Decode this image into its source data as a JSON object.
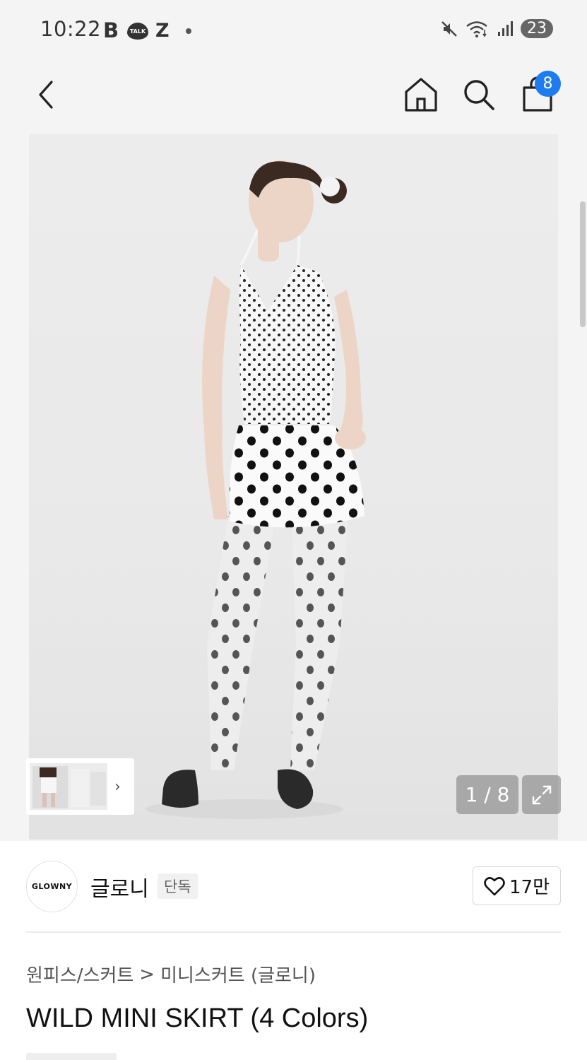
{
  "status_bar": {
    "time": "10:22",
    "icons": [
      "b-app-icon",
      "kakaotalk-icon",
      "z-app-icon",
      "dot-icon"
    ],
    "talk_label": "TALK",
    "b_label": "B",
    "z_label": "Z",
    "notification_count": "23"
  },
  "app_bar": {
    "cart_count": "8"
  },
  "gallery": {
    "counter": "1 / 8"
  },
  "brand": {
    "logo_text": "GLOWNY",
    "name": "글로니",
    "tag": "단독",
    "likes": "17만"
  },
  "breadcrumb": {
    "category": "원피스/스커트",
    "separator": ">",
    "subcategory": "미니스커트 (글로니)"
  },
  "product": {
    "title": "WILD MINI SKIRT (4 Colors)"
  },
  "colors": {
    "accent": "#1e7bf0",
    "background": "#f4f4f4"
  }
}
